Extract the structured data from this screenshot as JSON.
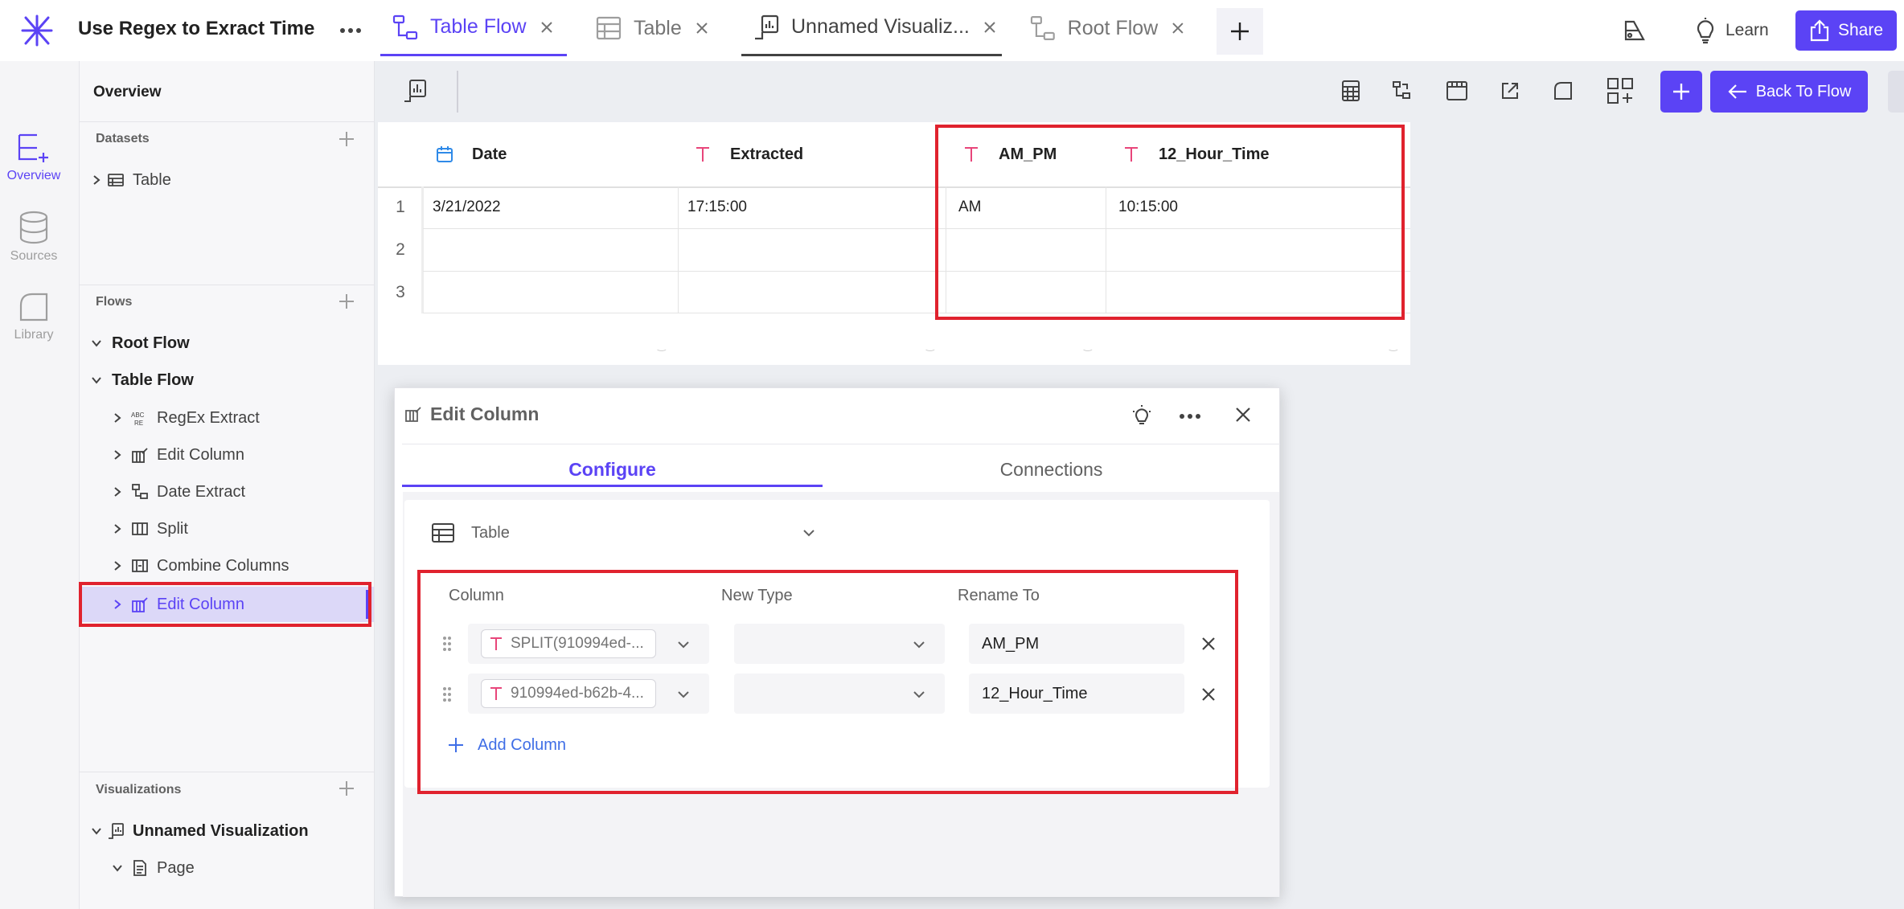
{
  "header": {
    "app_title": "Use Regex to Exract Time",
    "tabs": [
      {
        "label": "Table Flow"
      },
      {
        "label": "Table"
      },
      {
        "label": "Unnamed Visualiz..."
      },
      {
        "label": "Root Flow"
      }
    ],
    "learn_label": "Learn",
    "share_label": "Share"
  },
  "rail": {
    "items": [
      {
        "label": "Overview"
      },
      {
        "label": "Sources"
      },
      {
        "label": "Library"
      }
    ]
  },
  "sidebar": {
    "overview_label": "Overview",
    "datasets_label": "Datasets",
    "datasets": [
      {
        "label": "Table"
      }
    ],
    "flows_label": "Flows",
    "flows": [
      {
        "label": "Root Flow"
      },
      {
        "label": "Table Flow"
      }
    ],
    "flow_steps": [
      {
        "label": "RegEx Extract"
      },
      {
        "label": "Edit Column"
      },
      {
        "label": "Date Extract"
      },
      {
        "label": "Split"
      },
      {
        "label": "Combine Columns"
      },
      {
        "label": "Edit Column"
      }
    ],
    "visualizations_label": "Visualizations",
    "visualizations": [
      {
        "label": "Unnamed Visualization"
      }
    ],
    "pages": [
      {
        "label": "Page"
      }
    ]
  },
  "toolbar": {
    "back_label": "Back To Flow"
  },
  "grid": {
    "columns": [
      "Date",
      "Extracted",
      "AM_PM",
      "12_Hour_Time"
    ],
    "rows": [
      {
        "num": "1",
        "cells": [
          "3/21/2022",
          "17:15:00",
          "AM",
          "10:15:00"
        ]
      },
      {
        "num": "2",
        "cells": [
          "",
          "",
          "",
          ""
        ]
      },
      {
        "num": "3",
        "cells": [
          "",
          "",
          "",
          ""
        ]
      }
    ]
  },
  "dialog": {
    "title": "Edit Column",
    "tabs": [
      {
        "label": "Configure"
      },
      {
        "label": "Connections"
      }
    ],
    "table_select": "Table",
    "col_headers": {
      "column": "Column",
      "new_type": "New Type",
      "rename_to": "Rename To"
    },
    "rows": [
      {
        "column": "SPLIT(910994ed-...",
        "new_type": "",
        "rename": "AM_PM"
      },
      {
        "column": "910994ed-b62b-4...",
        "new_type": "",
        "rename": "12_Hour_Time"
      }
    ],
    "add_column_label": "Add Column"
  },
  "colors": {
    "accent": "#5b43f5",
    "highlight_box": "#e0222e",
    "text_type_icon": "#e8457a",
    "date_type_icon": "#2f8ae8",
    "link": "#3f6ee6"
  }
}
